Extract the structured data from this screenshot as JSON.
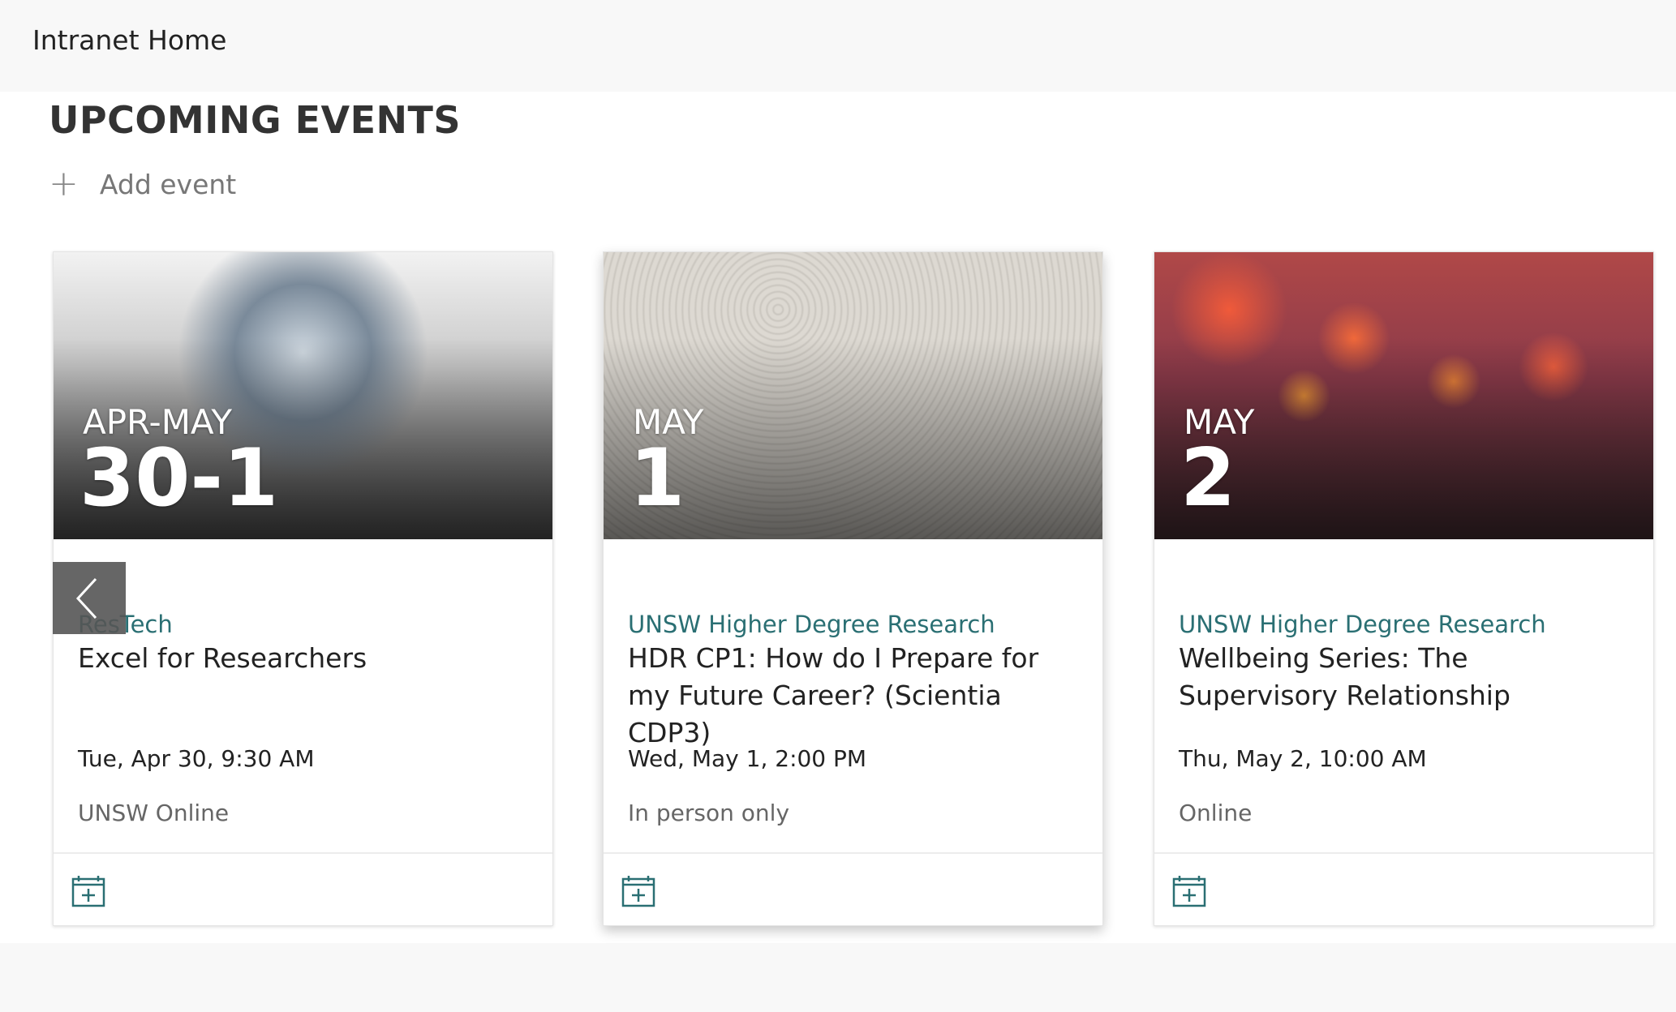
{
  "header": {
    "title": "Intranet Home"
  },
  "section": {
    "title": "UPCOMING EVENTS",
    "add_label": "Add event"
  },
  "colors": {
    "accent": "#2a6f73"
  },
  "events": [
    {
      "month": "APR-MAY",
      "day": "30-1",
      "category": "ResTech",
      "title": "Excel for Researchers",
      "when": "Tue, Apr 30, 9:30 AM",
      "where": "UNSW Online"
    },
    {
      "month": "MAY",
      "day": "1",
      "category": "UNSW Higher Degree Research",
      "title": "HDR CP1: How do I Prepare for my Future Career? (Scientia CDP3)",
      "when": "Wed, May 1, 2:00 PM",
      "where": "In person only"
    },
    {
      "month": "MAY",
      "day": "2",
      "category": "UNSW Higher Degree Research",
      "title": "Wellbeing Series: The Supervisory Relationship",
      "when": "Thu, May 2, 10:00 AM",
      "where": "Online"
    }
  ]
}
